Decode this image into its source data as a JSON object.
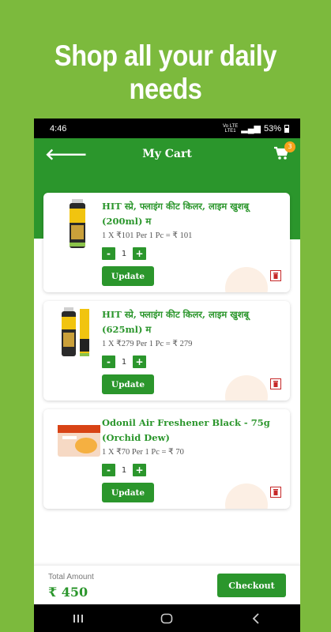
{
  "banner": {
    "text": "Shop all your daily needs"
  },
  "status_bar": {
    "time": "4:46",
    "network": "Vo LTE\nLTE1",
    "battery": "53%"
  },
  "app_bar": {
    "title": "My Cart",
    "cart_count": "3"
  },
  "cart": {
    "items": [
      {
        "name": "HIT स्प्रे, फ्लाइंग कीट किलर, लाइम खुशबू (200ml) म",
        "price_line": "1 X ₹101 Per 1 Pc = ₹ 101",
        "quantity": "1",
        "minus": "-",
        "plus": "+",
        "update_label": "Update"
      },
      {
        "name": "HIT स्प्रे, फ्लाइंग कीट किलर, लाइम खुशबू (625ml) म",
        "price_line": "1 X ₹279 Per 1 Pc = ₹ 279",
        "quantity": "1",
        "minus": "-",
        "plus": "+",
        "update_label": "Update"
      },
      {
        "name": "Odonil Air Freshener Black - 75g (Orchid Dew)",
        "price_line": "1 X ₹70 Per 1 Pc = ₹ 70",
        "quantity": "1",
        "minus": "-",
        "plus": "+",
        "update_label": "Update"
      }
    ]
  },
  "footer": {
    "total_label": "Total Amount",
    "total_value": "₹ 450",
    "checkout_label": "Checkout"
  },
  "colors": {
    "brand_green": "#2b962c",
    "background_green": "#7cba3d",
    "badge_orange": "#f7a21b",
    "trash_red": "#c62828"
  },
  "icons": {
    "back": "back-arrow-icon",
    "cart": "cart-icon",
    "trash": "trash-icon",
    "nav": [
      "recent-apps-icon",
      "home-icon",
      "back-nav-icon"
    ]
  }
}
